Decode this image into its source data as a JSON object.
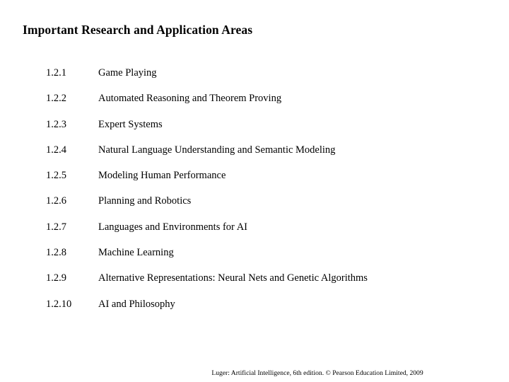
{
  "slide": {
    "title": "Important Research and Application Areas",
    "background_color": "#ffffff",
    "text_color": "#000000",
    "topics": [
      {
        "number": "1.2.1",
        "label": "Game Playing"
      },
      {
        "number": "1.2.2",
        "label": "Automated Reasoning and Theorem Proving"
      },
      {
        "number": "1.2.3",
        "label": "Expert Systems"
      },
      {
        "number": "1.2.4",
        "label": "Natural Language Understanding and Semantic Modeling"
      },
      {
        "number": "1.2.5",
        "label": "Modeling Human Performance"
      },
      {
        "number": "1.2.6",
        "label": "Planning and Robotics"
      },
      {
        "number": "1.2.7",
        "label": "Languages and Environments for AI"
      },
      {
        "number": "1.2.8",
        "label": "Machine Learning"
      },
      {
        "number": "1.2.9",
        "label": "Alternative Representations: Neural Nets and Genetic Algorithms"
      },
      {
        "number": "1.2.10",
        "label": "AI and Philosophy"
      }
    ],
    "footer": "Luger: Artificial Intelligence, 6th edition. © Pearson Education Limited, 2009"
  }
}
